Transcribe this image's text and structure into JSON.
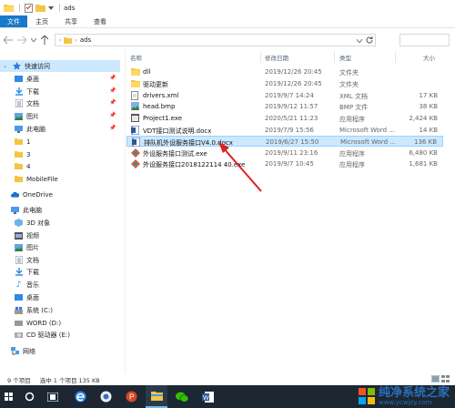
{
  "window": {
    "title": "ads"
  },
  "ribbon": {
    "tabs": [
      "文件",
      "主页",
      "共享",
      "查看"
    ]
  },
  "address": {
    "path": "ads"
  },
  "sidebar": {
    "quick_access": "快速访问",
    "pinned": [
      "桌面",
      "下载",
      "文档",
      "图片",
      "此电脑"
    ],
    "folders": [
      "1",
      "3",
      "4",
      "MobileFile"
    ],
    "onedrive": "OneDrive",
    "this_pc": "此电脑",
    "pc_items": [
      "3D 对象",
      "视频",
      "图片",
      "文档",
      "下载",
      "音乐",
      "桌面",
      "系统 (C:)",
      "WORD (D:)",
      "CD 驱动器 (E:)"
    ],
    "network": "网络"
  },
  "columns": {
    "name": "名称",
    "date": "修改日期",
    "type": "类型",
    "size": "大小"
  },
  "files": [
    {
      "name": "dll",
      "date": "2019/12/26 20:45",
      "type": "文件夹",
      "size": "",
      "icon": "folder"
    },
    {
      "name": "驱动更新",
      "date": "2019/12/26 20:45",
      "type": "文件夹",
      "size": "",
      "icon": "folder"
    },
    {
      "name": "drivers.xml",
      "date": "2019/9/7 14:24",
      "type": "XML 文档",
      "size": "17 KB",
      "icon": "xml"
    },
    {
      "name": "head.bmp",
      "date": "2019/9/12 11:57",
      "type": "BMP 文件",
      "size": "38 KB",
      "icon": "bmp"
    },
    {
      "name": "Project1.exe",
      "date": "2020/5/21 11:23",
      "type": "应用程序",
      "size": "2,424 KB",
      "icon": "exe"
    },
    {
      "name": "VDT接口测试说明.docx",
      "date": "2019/7/9 15:56",
      "type": "Microsoft Word ...",
      "size": "14 KB",
      "icon": "docx"
    },
    {
      "name": "排队机外设服务接口V4.0.docx",
      "date": "2019/6/27 15:50",
      "type": "Microsoft Word ...",
      "size": "136 KB",
      "icon": "docx",
      "selected": true
    },
    {
      "name": "外设服务接口测试.exe",
      "date": "2019/9/11 23:16",
      "type": "应用程序",
      "size": "6,480 KB",
      "icon": "exe-color"
    },
    {
      "name": "外设服务接口2018122114 40.exe",
      "date": "2019/9/7 10:45",
      "type": "应用程序",
      "size": "1,681 KB",
      "icon": "exe-color"
    }
  ],
  "status": {
    "count": "9 个项目",
    "selected": "选中 1 个项目  135 KB"
  },
  "watermark": {
    "brand": "纯净系统之家",
    "url": "www.ycwjzy.com"
  },
  "colors": {
    "file_tab": "#1979ca",
    "selection": "#cce8ff",
    "taskbar": "#1c2733",
    "arrow": "#e02020"
  }
}
